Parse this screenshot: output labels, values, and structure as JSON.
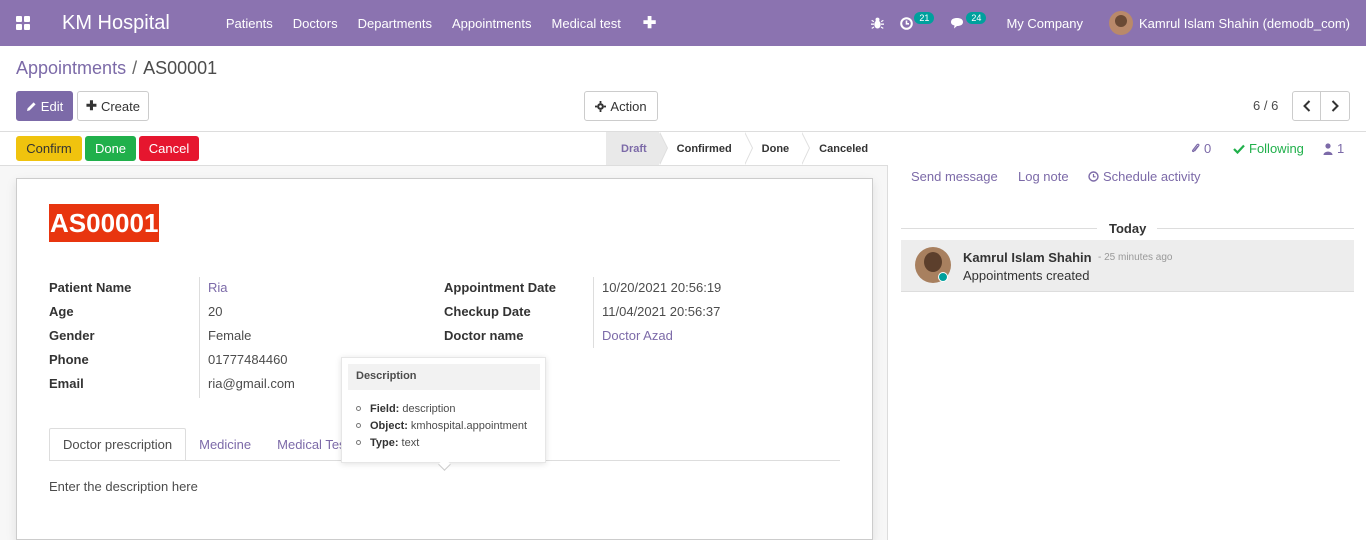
{
  "navbar": {
    "brand": "KM Hospital",
    "menu": [
      "Patients",
      "Doctors",
      "Departments",
      "Appointments",
      "Medical test"
    ],
    "activities_count": "21",
    "messages_count": "24",
    "company": "My Company",
    "user": "Kamrul Islam Shahin (demodb_com)"
  },
  "breadcrumb": {
    "parent": "Appointments",
    "separator": "/",
    "current": "AS00001"
  },
  "toolbar": {
    "edit_label": "Edit",
    "create_label": "Create",
    "action_label": "Action"
  },
  "pager": {
    "value": "6 / 6"
  },
  "statusbar": {
    "buttons": {
      "confirm": "Confirm",
      "done": "Done",
      "cancel": "Cancel"
    },
    "stages": [
      "Draft",
      "Confirmed",
      "Done",
      "Canceled"
    ],
    "active_stage": "Draft"
  },
  "record": {
    "name": "AS00001",
    "left_fields": [
      {
        "label": "Patient Name",
        "value": "Ria"
      },
      {
        "label": "Age",
        "value": "20"
      },
      {
        "label": "Gender",
        "value": "Female"
      },
      {
        "label": "Phone",
        "value": "01777484460"
      },
      {
        "label": "Email",
        "value": "ria@gmail.com"
      }
    ],
    "right_fields": [
      {
        "label": "Appointment Date",
        "value": "10/20/2021 20:56:19"
      },
      {
        "label": "Checkup Date",
        "value": "11/04/2021 20:56:37"
      },
      {
        "label": "Doctor name",
        "value": "Doctor Azad"
      }
    ],
    "tabs": [
      "Doctor prescription",
      "Medicine",
      "Medical Tes"
    ],
    "description_placeholder": "Enter the description here"
  },
  "tooltip": {
    "title": "Description",
    "items": [
      {
        "key": "Field:",
        "value": "description"
      },
      {
        "key": "Object:",
        "value": "kmhospital.appointment"
      },
      {
        "key": "Type:",
        "value": "text"
      }
    ]
  },
  "chatter": {
    "attachments_count": "0",
    "following_label": "Following",
    "followers_count": "1",
    "actions": [
      "Send message",
      "Log note",
      "Schedule activity"
    ],
    "date_separator": "Today",
    "message": {
      "author": "Kamrul Islam Shahin",
      "time": "- 25 minutes ago",
      "body": "Appointments created"
    }
  },
  "colors": {
    "navbar": "#8b73b0",
    "primary": "#7c6aa8",
    "confirm": "#f0c30e",
    "done": "#20b04b",
    "cancel": "#e6162f",
    "record_name_bg": "#e8350f"
  }
}
